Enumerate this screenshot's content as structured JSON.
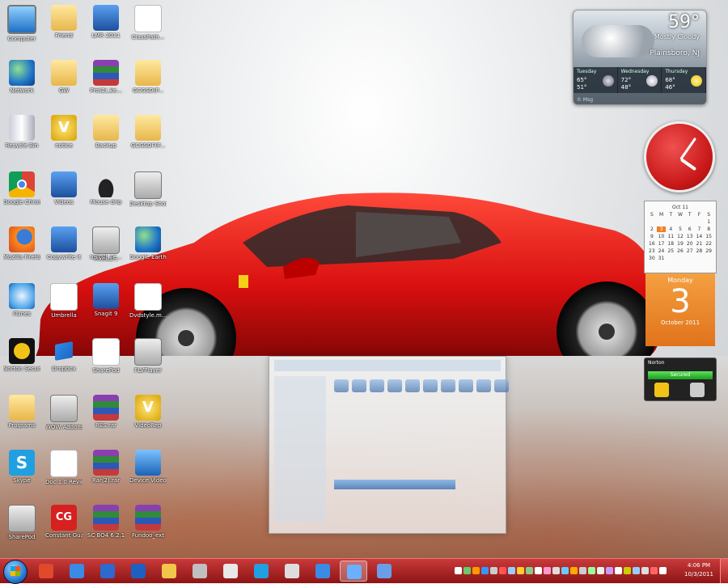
{
  "desktop": {
    "icons": [
      {
        "label": "Computer",
        "glyph": "g-monitor"
      },
      {
        "label": "Network",
        "glyph": "g-globe"
      },
      {
        "label": "Recycle Bin",
        "glyph": "g-bin"
      },
      {
        "label": "Google Chrome",
        "glyph": "g-chrome"
      },
      {
        "label": "Mozilla Firefox",
        "glyph": "g-firefox"
      },
      {
        "label": "iTunes",
        "glyph": "g-itunes"
      },
      {
        "label": "Norton Security Suite",
        "glyph": "g-norton"
      },
      {
        "label": "Programs",
        "glyph": "g-folder"
      },
      {
        "label": "Skype",
        "glyph": "g-skype"
      },
      {
        "label": "SharePod",
        "glyph": "g-box"
      },
      {
        "label": "Friend",
        "glyph": "g-folder"
      },
      {
        "label": "GW",
        "glyph": "g-folder"
      },
      {
        "label": "notice",
        "glyph": "g-v"
      },
      {
        "label": "Videos",
        "glyph": "g-blue"
      },
      {
        "label": "Copywrite it",
        "glyph": "g-blue"
      },
      {
        "label": "Umbrella",
        "glyph": "g-doc"
      },
      {
        "label": "Dropbox",
        "glyph": "g-dropbox"
      },
      {
        "label": "WOW Addons (2)",
        "glyph": "g-box"
      },
      {
        "label": "Doc 1.0 Review Key",
        "glyph": "g-doc"
      },
      {
        "label": "Constant Guard",
        "glyph": "g-cg"
      },
      {
        "label": "LMR 2011",
        "glyph": "g-blue"
      },
      {
        "label": "Pro(2)_ke...",
        "glyph": "g-rar"
      },
      {
        "label": "Backup",
        "glyph": "g-folder"
      },
      {
        "label": "Mouse drip",
        "glyph": "g-drop"
      },
      {
        "label": "Install_se...",
        "glyph": "g-globe"
      },
      {
        "label": "Snagit 9",
        "glyph": "g-blue"
      },
      {
        "label": "SharePod",
        "glyph": "g-doc"
      },
      {
        "label": "RES.rar",
        "glyph": "g-rar"
      },
      {
        "label": "Rar(2).rar",
        "glyph": "g-rar"
      },
      {
        "label": "SC BO4 6.2.1",
        "glyph": "g-rar"
      },
      {
        "label": "ClassPath...",
        "glyph": "g-doc"
      },
      {
        "label": "GCGSD(P...",
        "glyph": "g-folder"
      },
      {
        "label": "GCGSDF(P...",
        "glyph": "g-folder"
      },
      {
        "label": "Desktop Shortcut",
        "glyph": "g-box"
      },
      {
        "label": "Google Earth",
        "glyph": "g-globe"
      },
      {
        "label": "Dvdstyle.m...",
        "glyph": "g-doc"
      },
      {
        "label": "FLVPlayer",
        "glyph": "g-box"
      },
      {
        "label": "VideoRep",
        "glyph": "g-v"
      },
      {
        "label": "Device Video Capture Kit",
        "glyph": "g-fd"
      },
      {
        "label": "Fundoo_ext",
        "glyph": "g-rar"
      },
      {
        "label": "Pixel_s...",
        "glyph": "g-box"
      }
    ]
  },
  "weather": {
    "temp": "59°",
    "condition": "Mostly Cloudy",
    "location": "Plainsboro, NJ",
    "days": [
      {
        "name": "Tuesday",
        "hi": "65°",
        "lo": "51°",
        "icon": "rain-icon"
      },
      {
        "name": "Wednesday",
        "hi": "72°",
        "lo": "48°",
        "icon": "cloud-icon"
      },
      {
        "name": "Thursday",
        "hi": "68°",
        "lo": "46°",
        "icon": "sun-icon"
      }
    ],
    "footer": "© Msg"
  },
  "calendar": {
    "month_header": "Oct 11",
    "weekday_headers": [
      "S",
      "M",
      "T",
      "W",
      "T",
      "F",
      "S"
    ],
    "dates": [
      "",
      "",
      "",
      "",
      "",
      "",
      "1",
      "2",
      "3",
      "4",
      "5",
      "6",
      "7",
      "8",
      "9",
      "10",
      "11",
      "12",
      "13",
      "14",
      "15",
      "16",
      "17",
      "18",
      "19",
      "20",
      "21",
      "22",
      "23",
      "24",
      "25",
      "26",
      "27",
      "28",
      "29",
      "30",
      "31"
    ],
    "selected": "3",
    "day_of_week": "Monday",
    "day_number": "3",
    "month_year": "October 2011"
  },
  "norton": {
    "title": "Norton",
    "status": "Secured"
  },
  "taskbar": {
    "time": "4:06 PM",
    "date": "10/3/2011",
    "pinned": [
      "chrome-icon",
      "ie-icon",
      "media-player-icon",
      "word-icon",
      "explorer-icon",
      "pencil-icon",
      "doc-icon",
      "skype-icon",
      "usb-icon",
      "ie-icon",
      "snagit-icon",
      "disk-icon"
    ]
  }
}
